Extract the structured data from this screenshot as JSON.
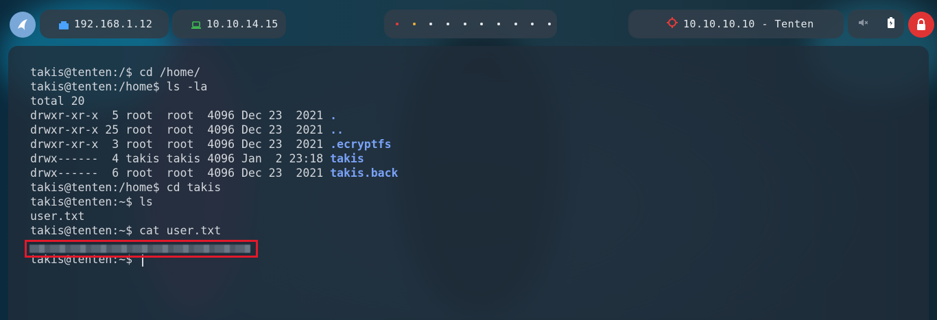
{
  "topbar": {
    "local_ip": "192.168.1.12",
    "vpn_ip": "10.10.14.15",
    "target": "10.10.10.10 - Tenten",
    "workspace_dots": 10,
    "colors": {
      "accent": "#79a8d8",
      "danger": "#e03434",
      "vpn": "#3fbf4f"
    }
  },
  "terminal": {
    "lines": [
      [
        {
          "t": "takis@tenten:/$ cd /home/"
        }
      ],
      [
        {
          "t": "takis@tenten:/home$ ls -la"
        }
      ],
      [
        {
          "t": "total 20"
        }
      ],
      [
        {
          "t": "drwxr-xr-x  5 root  root  4096 Dec 23  2021 "
        },
        {
          "t": ".",
          "c": "dir"
        }
      ],
      [
        {
          "t": "drwxr-xr-x 25 root  root  4096 Dec 23  2021 "
        },
        {
          "t": "..",
          "c": "dir"
        }
      ],
      [
        {
          "t": "drwxr-xr-x  3 root  root  4096 Dec 23  2021 "
        },
        {
          "t": ".ecryptfs",
          "c": "dir"
        }
      ],
      [
        {
          "t": "drwx------  4 takis takis 4096 Jan  2 23:18 "
        },
        {
          "t": "takis",
          "c": "dir"
        }
      ],
      [
        {
          "t": "drwx------  6 root  root  4096 Dec 23  2021 "
        },
        {
          "t": "takis.back",
          "c": "dir"
        }
      ],
      [
        {
          "t": "takis@tenten:/home$ cd takis"
        }
      ],
      [
        {
          "t": "takis@tenten:~$ ls"
        }
      ],
      [
        {
          "t": "user.txt"
        }
      ],
      [
        {
          "t": "takis@tenten:~$ cat user.txt"
        }
      ],
      [
        {
          "t": ""
        }
      ],
      [
        {
          "t": "takis@tenten:~$ "
        }
      ]
    ]
  }
}
